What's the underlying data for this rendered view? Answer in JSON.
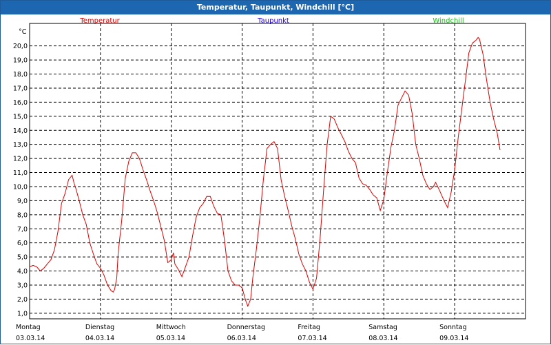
{
  "window": {
    "title": "Temperatur, Taupunkt, Windchill [°C]"
  },
  "colors": {
    "titlebar": "#1d66b0",
    "temperature": "#dd0000",
    "dewpoint": "#2200cc",
    "windchill": "#22bb22"
  },
  "chart_data": {
    "type": "line",
    "title": "Temperatur, Taupunkt, Windchill [°C]",
    "ylabel": "°C",
    "ylim": [
      0.6,
      21.6
    ],
    "xlim": [
      0,
      7
    ],
    "grid": true,
    "legend_placement": "top",
    "yticks": [
      "1,0",
      "2,0",
      "3,0",
      "4,0",
      "5,0",
      "6,0",
      "7,0",
      "8,0",
      "9,0",
      "10,0",
      "11,0",
      "12,0",
      "13,0",
      "14,0",
      "15,0",
      "16,0",
      "17,0",
      "18,0",
      "19,0",
      "20,0"
    ],
    "days": [
      {
        "name": "Montag",
        "date": "03.03.14"
      },
      {
        "name": "Dienstag",
        "date": "04.03.14"
      },
      {
        "name": "Mittwoch",
        "date": "05.03.14"
      },
      {
        "name": "Donnerstag",
        "date": "06.03.14"
      },
      {
        "name": "Freitag",
        "date": "07.03.14"
      },
      {
        "name": "Samstag",
        "date": "08.03.14"
      },
      {
        "name": "Sonntag",
        "date": "09.03.14"
      }
    ],
    "series": [
      {
        "name": "Temperatur",
        "color": "#dd0000",
        "points": [
          [
            0.0,
            4.3
          ],
          [
            0.05,
            4.4
          ],
          [
            0.1,
            4.3
          ],
          [
            0.15,
            4.0
          ],
          [
            0.2,
            4.2
          ],
          [
            0.25,
            4.5
          ],
          [
            0.3,
            4.8
          ],
          [
            0.35,
            5.5
          ],
          [
            0.4,
            6.8
          ],
          [
            0.45,
            8.8
          ],
          [
            0.5,
            9.5
          ],
          [
            0.55,
            10.5
          ],
          [
            0.6,
            10.8
          ],
          [
            0.63,
            10.2
          ],
          [
            0.65,
            9.9
          ],
          [
            0.7,
            9.0
          ],
          [
            0.75,
            8.0
          ],
          [
            0.8,
            7.3
          ],
          [
            0.85,
            6.0
          ],
          [
            0.9,
            5.2
          ],
          [
            0.95,
            4.5
          ],
          [
            1.0,
            4.2
          ],
          [
            1.05,
            3.7
          ],
          [
            1.1,
            3.0
          ],
          [
            1.15,
            2.6
          ],
          [
            1.18,
            2.5
          ],
          [
            1.2,
            2.7
          ],
          [
            1.23,
            3.5
          ],
          [
            1.25,
            5.3
          ],
          [
            1.3,
            7.6
          ],
          [
            1.35,
            10.6
          ],
          [
            1.4,
            11.8
          ],
          [
            1.45,
            12.4
          ],
          [
            1.5,
            12.4
          ],
          [
            1.55,
            12.0
          ],
          [
            1.6,
            11.2
          ],
          [
            1.65,
            10.5
          ],
          [
            1.7,
            9.7
          ],
          [
            1.75,
            9.0
          ],
          [
            1.8,
            8.2
          ],
          [
            1.85,
            7.2
          ],
          [
            1.9,
            6.2
          ],
          [
            1.95,
            4.6
          ],
          [
            2.0,
            4.8
          ],
          [
            2.03,
            5.3
          ],
          [
            2.05,
            4.5
          ],
          [
            2.1,
            4.1
          ],
          [
            2.15,
            3.6
          ],
          [
            2.2,
            4.3
          ],
          [
            2.25,
            5.0
          ],
          [
            2.3,
            6.5
          ],
          [
            2.35,
            7.8
          ],
          [
            2.4,
            8.5
          ],
          [
            2.45,
            8.8
          ],
          [
            2.5,
            9.3
          ],
          [
            2.55,
            9.3
          ],
          [
            2.6,
            8.6
          ],
          [
            2.65,
            8.1
          ],
          [
            2.7,
            8.0
          ],
          [
            2.75,
            6.2
          ],
          [
            2.8,
            4.0
          ],
          [
            2.85,
            3.3
          ],
          [
            2.9,
            3.0
          ],
          [
            2.95,
            3.0
          ],
          [
            3.0,
            2.8
          ],
          [
            3.05,
            1.9
          ],
          [
            3.08,
            1.5
          ],
          [
            3.12,
            2.0
          ],
          [
            3.15,
            3.5
          ],
          [
            3.2,
            5.5
          ],
          [
            3.25,
            7.8
          ],
          [
            3.3,
            10.5
          ],
          [
            3.35,
            12.7
          ],
          [
            3.4,
            13.0
          ],
          [
            3.45,
            13.2
          ],
          [
            3.5,
            12.7
          ],
          [
            3.55,
            10.5
          ],
          [
            3.6,
            9.3
          ],
          [
            3.65,
            8.3
          ],
          [
            3.7,
            7.2
          ],
          [
            3.75,
            6.3
          ],
          [
            3.8,
            5.2
          ],
          [
            3.85,
            4.5
          ],
          [
            3.9,
            4.0
          ],
          [
            3.95,
            3.2
          ],
          [
            4.0,
            2.7
          ],
          [
            4.05,
            3.5
          ],
          [
            4.1,
            6.3
          ],
          [
            4.15,
            9.8
          ],
          [
            4.2,
            13.0
          ],
          [
            4.25,
            15.0
          ],
          [
            4.3,
            14.8
          ],
          [
            4.35,
            14.2
          ],
          [
            4.4,
            13.7
          ],
          [
            4.45,
            13.2
          ],
          [
            4.5,
            12.5
          ],
          [
            4.55,
            12.0
          ],
          [
            4.6,
            11.7
          ],
          [
            4.65,
            10.6
          ],
          [
            4.7,
            10.2
          ],
          [
            4.75,
            10.1
          ],
          [
            4.8,
            9.8
          ],
          [
            4.85,
            9.4
          ],
          [
            4.9,
            9.2
          ],
          [
            4.95,
            8.3
          ],
          [
            5.0,
            9.1
          ],
          [
            5.05,
            11.0
          ],
          [
            5.1,
            12.8
          ],
          [
            5.15,
            14.0
          ],
          [
            5.2,
            15.8
          ],
          [
            5.25,
            16.3
          ],
          [
            5.3,
            16.8
          ],
          [
            5.35,
            16.5
          ],
          [
            5.4,
            15.2
          ],
          [
            5.45,
            13.0
          ],
          [
            5.5,
            12.0
          ],
          [
            5.55,
            10.8
          ],
          [
            5.6,
            10.2
          ],
          [
            5.65,
            9.8
          ],
          [
            5.7,
            10.0
          ],
          [
            5.73,
            10.3
          ],
          [
            5.78,
            9.8
          ],
          [
            5.85,
            9.0
          ],
          [
            5.9,
            8.5
          ],
          [
            5.95,
            9.6
          ],
          [
            6.0,
            11.2
          ],
          [
            6.05,
            13.5
          ],
          [
            6.1,
            15.5
          ],
          [
            6.15,
            17.5
          ],
          [
            6.2,
            19.5
          ],
          [
            6.25,
            20.2
          ],
          [
            6.3,
            20.4
          ],
          [
            6.33,
            20.6
          ],
          [
            6.35,
            20.5
          ],
          [
            6.4,
            19.4
          ],
          [
            6.45,
            17.6
          ],
          [
            6.5,
            16.0
          ],
          [
            6.55,
            14.8
          ],
          [
            6.6,
            13.8
          ],
          [
            6.64,
            12.6
          ]
        ]
      },
      {
        "name": "Taupunkt",
        "color": "#2200cc",
        "points": []
      },
      {
        "name": "Windchill",
        "color": "#22bb22",
        "points": []
      }
    ]
  }
}
